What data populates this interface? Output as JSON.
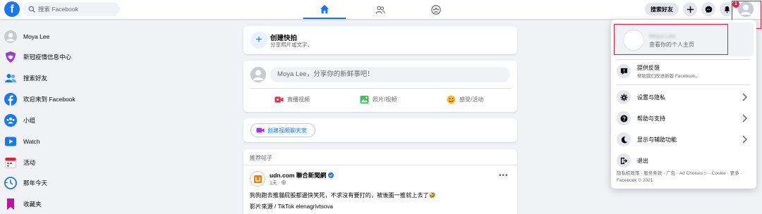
{
  "header": {
    "logo_letter": "f",
    "search_placeholder": "搜索 Facebook",
    "find_friends_label": "搜索好友",
    "notification_count": "1"
  },
  "sidebar": {
    "items": [
      {
        "label": "Moya Lee",
        "icon": "avatar-icon"
      },
      {
        "label": "新冠疫情信息中心",
        "icon": "covid-shield-icon"
      },
      {
        "label": "搜索好友",
        "icon": "friends-icon"
      },
      {
        "label": "欢迎来到 Facebook",
        "icon": "facebook-icon"
      },
      {
        "label": "小组",
        "icon": "groups-icon"
      },
      {
        "label": "Watch",
        "icon": "watch-icon"
      },
      {
        "label": "活动",
        "icon": "calendar-icon"
      },
      {
        "label": "那年今天",
        "icon": "clock-icon"
      },
      {
        "label": "收藏夹",
        "icon": "bookmark-icon"
      }
    ]
  },
  "story": {
    "title": "创建快拍",
    "subtitle": "分享照片或文字。"
  },
  "composer": {
    "placeholder": "Moya Lee，分享你的新鲜事吧！",
    "actions": [
      {
        "label": "直播视频",
        "icon": "live-video-icon"
      },
      {
        "label": "照片/视频",
        "icon": "photo-icon"
      },
      {
        "label": "感受/活动",
        "icon": "feeling-icon"
      }
    ]
  },
  "room": {
    "label": "创建视频聊天室"
  },
  "feed": {
    "header": "推荐帖子",
    "post": {
      "author": "udn.com 聯合新聞網",
      "meta": "1天 · ",
      "text": "狗狗跑去推貓屁股都邊快笑死，不求沒有要打的，被後面一推就上去了🤣",
      "text2": "影片來源 / TikTok elenagrivtsova",
      "more": "•••"
    }
  },
  "account_menu": {
    "profile_name": "Moya Lee",
    "profile_sub": "查看你的个人主页",
    "feedback_label": "提供反馈",
    "feedback_sub": "帮助我们改进新版 Facebook。",
    "items": [
      {
        "label": "设置与隐私",
        "icon": "gear-icon"
      },
      {
        "label": "帮助与支持",
        "icon": "help-icon"
      },
      {
        "label": "显示与辅助功能",
        "icon": "moon-icon"
      },
      {
        "label": "退出",
        "icon": "logout-icon"
      }
    ],
    "footer": "隐私权政策 · 服务条款 · 广告 · Ad Choices ▷ · Cookie · 更多 · Facebook © 2021"
  }
}
